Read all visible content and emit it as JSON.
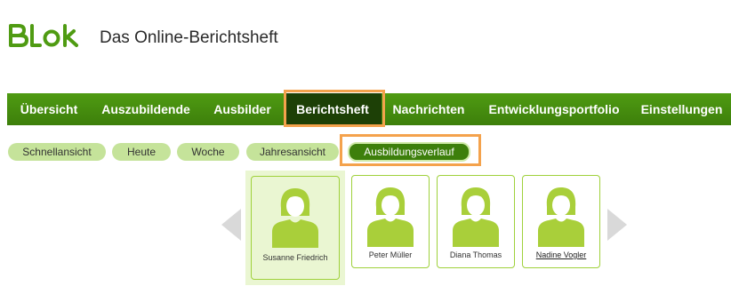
{
  "header": {
    "logo_text": "Blok",
    "app_title": "Das Online-Berichtsheft"
  },
  "mainnav": [
    {
      "label": "Übersicht"
    },
    {
      "label": "Auszubildende"
    },
    {
      "label": "Ausbilder"
    },
    {
      "label": "Berichtsheft",
      "active": true
    },
    {
      "label": "Nachrichten"
    },
    {
      "label": "Entwicklungsportfolio"
    },
    {
      "label": "Einstellungen"
    }
  ],
  "subnav": [
    {
      "label": "Schnellansicht"
    },
    {
      "label": "Heute"
    },
    {
      "label": "Woche"
    },
    {
      "label": "Jahresansicht"
    },
    {
      "label": "Ausbildungsverlauf",
      "active": true
    }
  ],
  "people": [
    {
      "name": "Susanne Friedrich",
      "selected": true
    },
    {
      "name": "Peter Müller"
    },
    {
      "name": "Diana Thomas"
    },
    {
      "name": "Nadine Vogler",
      "link": true
    }
  ],
  "colors": {
    "nav_green": "#4f9b12",
    "nav_active": "#1d4006",
    "pill_green": "#c5e39a",
    "avatar_green": "#a9cf3a",
    "highlight_orange": "#f4a24c"
  }
}
